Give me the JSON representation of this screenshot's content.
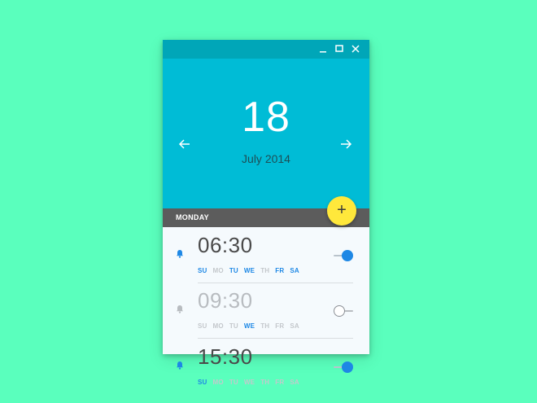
{
  "window": {
    "controls": {
      "minimize_icon": "minimize-icon",
      "maximize_icon": "maximize-icon",
      "close_icon": "close-icon"
    }
  },
  "header": {
    "day": "18",
    "month_year": "July 2014",
    "prev_icon": "arrow-left-icon",
    "next_icon": "arrow-right-icon"
  },
  "weekday": "MONDAY",
  "fab": {
    "icon": "plus-icon",
    "label": "+"
  },
  "alarms": [
    {
      "time": "06:30",
      "enabled": true,
      "days": [
        {
          "label": "SU",
          "active": true
        },
        {
          "label": "MO",
          "active": false
        },
        {
          "label": "TU",
          "active": true
        },
        {
          "label": "WE",
          "active": true
        },
        {
          "label": "TH",
          "active": false
        },
        {
          "label": "FR",
          "active": true
        },
        {
          "label": "SA",
          "active": true
        }
      ]
    },
    {
      "time": "09:30",
      "enabled": false,
      "days": [
        {
          "label": "SU",
          "active": false
        },
        {
          "label": "MO",
          "active": false
        },
        {
          "label": "TU",
          "active": false
        },
        {
          "label": "WE",
          "active": true
        },
        {
          "label": "TH",
          "active": false
        },
        {
          "label": "FR",
          "active": false
        },
        {
          "label": "SA",
          "active": false
        }
      ]
    },
    {
      "time": "15:30",
      "enabled": true,
      "days": [
        {
          "label": "SU",
          "active": true
        },
        {
          "label": "MO",
          "active": false
        },
        {
          "label": "TU",
          "active": false
        },
        {
          "label": "WE",
          "active": false
        },
        {
          "label": "TH",
          "active": false
        },
        {
          "label": "FR",
          "active": false
        },
        {
          "label": "SA",
          "active": false
        }
      ]
    }
  ],
  "colors": {
    "background": "#5affbd",
    "titlebar": "#00a6b8",
    "header": "#00bcd6",
    "weekday_bar": "#5c5c5c",
    "fab": "#ffe83b",
    "accent": "#1e88e5",
    "time_enabled": "#4a4a4a",
    "time_disabled": "#b8bcc0",
    "day_inactive": "#c4c8cc"
  }
}
